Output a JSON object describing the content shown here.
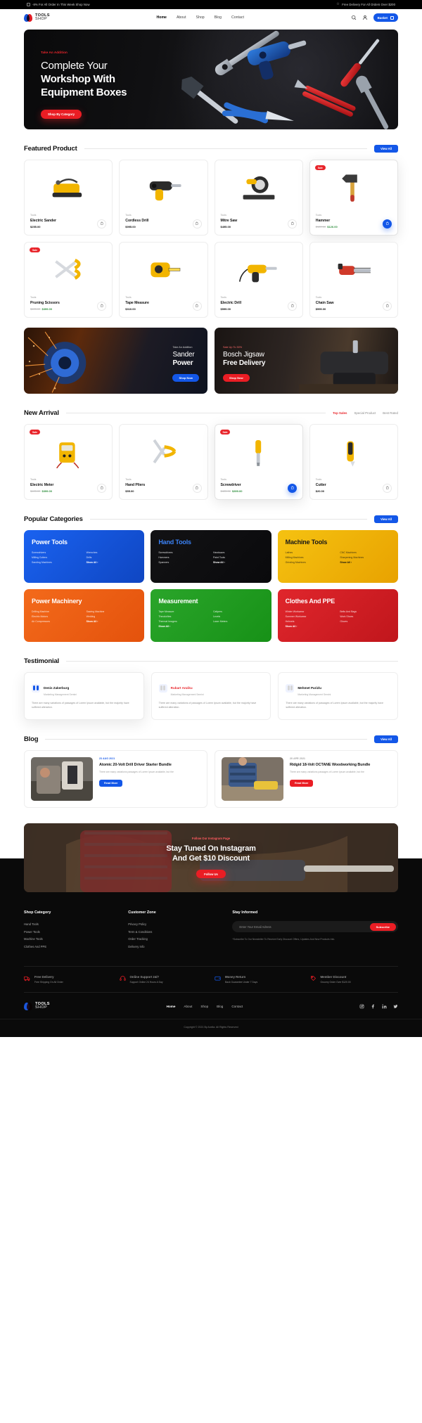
{
  "announce": {
    "left": "-8% For All Order In This Week Shop Now",
    "right": "Free Delivery For All Orders Over $200",
    "left_icon": "tag-icon",
    "right_icon": "star-icon"
  },
  "header": {
    "logo_top": "TOOLS",
    "logo_bottom": "SHOP",
    "nav": [
      {
        "label": "Home",
        "active": true
      },
      {
        "label": "About",
        "active": false
      },
      {
        "label": "Shop",
        "active": false
      },
      {
        "label": "Blog",
        "active": false
      },
      {
        "label": "Contact",
        "active": false
      }
    ],
    "search_icon": "search-icon",
    "account_icon": "user-icon",
    "basket_label": "Basket",
    "basket_icon": "bag-icon"
  },
  "hero": {
    "kicker": "Take An Addition",
    "line1": "Complete Your",
    "line2": "Workshop With",
    "line3": "Equipment Boxes",
    "cta": "Shop By Category"
  },
  "featured": {
    "title": "Featured Product",
    "view_all": "View All",
    "products": [
      {
        "badge": "",
        "category": "Tools",
        "name": "Electric Sander",
        "price": "$255.00",
        "old": "",
        "sale": "",
        "selected": false,
        "cart_blue": false,
        "img": "sander"
      },
      {
        "badge": "",
        "category": "Tools",
        "name": "Cordless Drill",
        "price": "$995.00",
        "old": "",
        "sale": "",
        "selected": false,
        "cart_blue": false,
        "img": "drill"
      },
      {
        "badge": "",
        "category": "Tools",
        "name": "Mitre Saw",
        "price": "$495.00",
        "old": "",
        "sale": "",
        "selected": false,
        "cart_blue": false,
        "img": "mitresaw"
      },
      {
        "badge": "Sale",
        "category": "Tools",
        "name": "Hammer",
        "price": "",
        "old": "$120.00",
        "sale": "$126.00",
        "selected": true,
        "cart_blue": true,
        "img": "hammer"
      },
      {
        "badge": "Sale",
        "category": "Tools",
        "name": "Pruning Scissors",
        "price": "",
        "old": "$425.00",
        "sale": "$399.00",
        "selected": false,
        "cart_blue": false,
        "img": "scissors"
      },
      {
        "badge": "",
        "category": "Tools",
        "name": "Tape Measure",
        "price": "$310.00",
        "old": "",
        "sale": "",
        "selected": false,
        "cart_blue": false,
        "img": "tape"
      },
      {
        "badge": "",
        "category": "Tools",
        "name": "Electric Drill",
        "price": "$599.00",
        "old": "",
        "sale": "",
        "selected": false,
        "cart_blue": false,
        "img": "edrill"
      },
      {
        "badge": "",
        "category": "Tools",
        "name": "Chain Saw",
        "price": "$599.00",
        "old": "",
        "sale": "",
        "selected": false,
        "cart_blue": false,
        "img": "chainsaw"
      }
    ]
  },
  "promos": [
    {
      "kicker": "Take An Addition",
      "line1": "Sander",
      "line2": "Power",
      "cta": "Shop Now",
      "style": "a"
    },
    {
      "kicker": "Sale Up To 30%",
      "line1": "Bosch Jigsaw",
      "line2": "Free Delivery",
      "cta": "Shop Now",
      "style": "b"
    }
  ],
  "new_arrival": {
    "title": "New Arrival",
    "tabs": [
      {
        "label": "Top Sales",
        "active": true
      },
      {
        "label": "Special Product",
        "active": false
      },
      {
        "label": "Best Rated",
        "active": false
      }
    ],
    "products": [
      {
        "badge": "Sale",
        "category": "Tools",
        "name": "Electric Meter",
        "price": "",
        "old": "$425.00",
        "sale": "$399.00",
        "selected": false,
        "cart_blue": false,
        "img": "meter"
      },
      {
        "badge": "",
        "category": "Tools",
        "name": "Hand Pliers",
        "price": "$55.00",
        "old": "",
        "sale": "",
        "selected": false,
        "cart_blue": false,
        "img": "pliers"
      },
      {
        "badge": "Sale",
        "category": "Tools",
        "name": "Screwdriver",
        "price": "",
        "old": "$425.00",
        "sale": "$399.00",
        "selected": true,
        "cart_blue": true,
        "img": "screwdriver"
      },
      {
        "badge": "",
        "category": "Tools",
        "name": "Cutter",
        "price": "$20.00",
        "old": "",
        "sale": "",
        "selected": false,
        "cart_blue": false,
        "img": "cutter"
      }
    ]
  },
  "categories": {
    "title": "Popular Categories",
    "view_all": "View All",
    "show_all": "Show All",
    "cards": [
      {
        "name": "Power Tools",
        "style": "c-power",
        "links": [
          "Screwdrivers",
          "Wrenches",
          "Milling Cutters",
          "Drills",
          "Sanding Machines"
        ]
      },
      {
        "name": "Hand Tools",
        "style": "c-hand",
        "links": [
          "Screwdrivers",
          "Handsaws",
          "Hammers",
          "Paint Tools",
          "Spanners"
        ]
      },
      {
        "name": "Machine Tools",
        "style": "c-mach",
        "links": [
          "Lathes",
          "CNC Machines",
          "Milling Machines",
          "Sharpening Machines",
          "Grinding Machines"
        ]
      },
      {
        "name": "Power Machinery",
        "style": "c-pm",
        "links": [
          "Drilling Machine",
          "Sawing Machine",
          "Electric Motors",
          "Welding",
          "Air Compressors"
        ]
      },
      {
        "name": "Measurement",
        "style": "c-meas",
        "links": [
          "Tape Measure",
          "Calipers",
          "Theodolites",
          "Levels",
          "Thermal Imagers",
          "Laser Meters"
        ]
      },
      {
        "name": "Clothes And PPE",
        "style": "c-ppe",
        "links": [
          "Winter Workwear",
          "Belts And Bags",
          "Summer Workwear",
          "Work Shoes",
          "Helmets",
          "Gloves"
        ]
      }
    ]
  },
  "testimonial": {
    "title": "Testimonial",
    "items": [
      {
        "name": "Denis Zakerburg",
        "role": "Marketing Management Semini",
        "highlight": true,
        "red": false,
        "text": "There are many variations of passages of Lorem Ipsum available, but the majority have suffered alteration."
      },
      {
        "name": "Rubart Anziku",
        "role": "Marketing Management Semini",
        "highlight": false,
        "red": true,
        "text": "There are many variations of passages of Lorem Ipsum available, but the majority have suffered alteration."
      },
      {
        "name": "Mehmet Parizlu",
        "role": "Marketing Management Semini",
        "highlight": false,
        "red": false,
        "text": "There are many variations of passages of Lorem Ipsum available, but the majority have suffered alteration."
      }
    ]
  },
  "blog": {
    "title": "Blog",
    "view_all": "View All",
    "posts": [
      {
        "date": "23 AUG 2021",
        "date_style": "blue",
        "title": "Atomic 20-Volt Drill Driver Starter Bundle",
        "excerpt": "There are many variations passages of Lorem Ipsum available, but the",
        "cta": "Read More",
        "cta_style": "blue",
        "img": "blog1"
      },
      {
        "date": "20 APR 2021",
        "date_style": "gray",
        "title": "Ridgid 18-Volt OCTANE Woodworking Bundle",
        "excerpt": "There are many variations passages of Lorem Ipsum available, but the",
        "cta": "Read More",
        "cta_style": "red",
        "img": "blog2"
      }
    ]
  },
  "instagram": {
    "kicker": "Follow Our Instagram Page",
    "line1": "Stay Tuned On Instagram",
    "line2": "And Get $10 Discount",
    "cta": "Follow Us"
  },
  "footer": {
    "shop_category": {
      "title": "Shop Category",
      "links": [
        "Hand Tools",
        "Power Tools",
        "Machine Tools",
        "Clothes And PPE"
      ]
    },
    "customer_zone": {
      "title": "Customer Zone",
      "links": [
        "Privacy Policy",
        "Term & Conditions",
        "Order Tracking",
        "Delivery Info"
      ]
    },
    "newsletter": {
      "title": "Stay Informed",
      "placeholder": "Enter Your Email Adress",
      "value": "",
      "button": "Subscribe",
      "note": "*Subscribe To Our Newsletter To Receive Early Discount Offers, Updates And New Products Info."
    },
    "features": [
      {
        "icon": "truck-icon",
        "title": "Free Delivery",
        "sub": "Free Shipping On All Order",
        "color": "#ea1d24"
      },
      {
        "icon": "headset-icon",
        "title": "Online Support 24/7",
        "sub": "Support Online 24 Hours A Day",
        "color": "#ea1d24"
      },
      {
        "icon": "wallet-icon",
        "title": "Money Return",
        "sub": "Back Guarantee Under 7 Days",
        "color": "#1357e8"
      },
      {
        "icon": "discount-icon",
        "title": "Member Discount",
        "sub": "Grocery Order Over $120.00",
        "color": "#ea1d24"
      }
    ],
    "logo_top": "TOOLS",
    "logo_bottom": "SHOP",
    "nav": [
      {
        "label": "Home",
        "active": true
      },
      {
        "label": "About",
        "active": false
      },
      {
        "label": "Shop",
        "active": false
      },
      {
        "label": "Blog",
        "active": false
      },
      {
        "label": "Contact",
        "active": false
      }
    ],
    "socials": [
      "instagram-icon",
      "facebook-icon",
      "linkedin-icon",
      "twitter-icon"
    ],
    "copyright": "Copyright © 2021 By Axelia. All Rights Reserved"
  },
  "colors": {
    "brand_blue": "#1357e8",
    "brand_red": "#ea1d24",
    "dark": "#0a0a0a"
  }
}
